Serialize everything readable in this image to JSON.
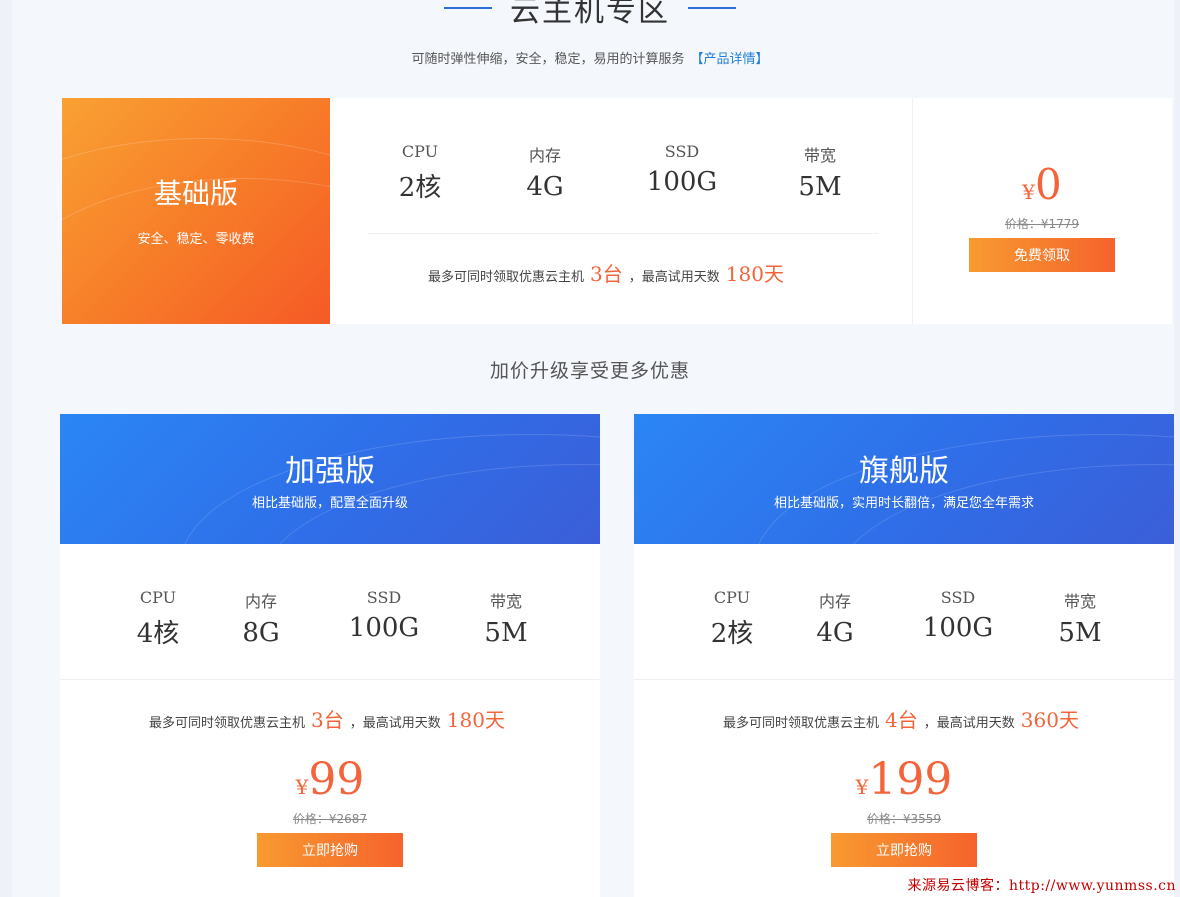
{
  "header": {
    "title": "云主机专区",
    "subtitle": "可随时弹性伸缩，安全，稳定，易用的计算服务",
    "details_link": "【产品详情】"
  },
  "basic": {
    "name": "基础版",
    "tagline": "安全、稳定、零收费",
    "specs": [
      {
        "label": "CPU",
        "value": "2核"
      },
      {
        "label": "内存",
        "value": "4G"
      },
      {
        "label": "SSD",
        "value": "100G"
      },
      {
        "label": "带宽",
        "value": "5M"
      }
    ],
    "limit_prefix": "最多可同时领取优惠云主机",
    "limit_count": "3台",
    "limit_mid": "，最高试用天数",
    "limit_days": "180天",
    "currency": "¥",
    "price": "0",
    "original_price": "价格：¥1779",
    "button": "免费领取"
  },
  "upgrade_title": "加价升级享受更多优惠",
  "plans": [
    {
      "name": "加强版",
      "tagline": "相比基础版，配置全面升级",
      "specs": [
        {
          "label": "CPU",
          "value": "4核"
        },
        {
          "label": "内存",
          "value": "8G"
        },
        {
          "label": "SSD",
          "value": "100G"
        },
        {
          "label": "带宽",
          "value": "5M"
        }
      ],
      "limit_prefix": "最多可同时领取优惠云主机",
      "limit_count": "3台",
      "limit_mid": "，最高试用天数",
      "limit_days": "180天",
      "currency": "¥",
      "price": "99",
      "original_price": "价格：¥2687",
      "button": "立即抢购"
    },
    {
      "name": "旗舰版",
      "tagline": "相比基础版，实用时长翻倍，满足您全年需求",
      "specs": [
        {
          "label": "CPU",
          "value": "2核"
        },
        {
          "label": "内存",
          "value": "4G"
        },
        {
          "label": "SSD",
          "value": "100G"
        },
        {
          "label": "带宽",
          "value": "5M"
        }
      ],
      "limit_prefix": "最多可同时领取优惠云主机",
      "limit_count": "4台",
      "limit_mid": "，最高试用天数",
      "limit_days": "360天",
      "currency": "¥",
      "price": "199",
      "original_price": "价格：¥3559",
      "button": "立即抢购"
    }
  ],
  "watermark": "来源易云博客：http://www.yunmss.cn",
  "colors": {
    "accent_orange": "#f4643a",
    "banner_orange": "#f77a28",
    "banner_blue": "#2f6ee8",
    "link_blue": "#1f7fd8"
  }
}
